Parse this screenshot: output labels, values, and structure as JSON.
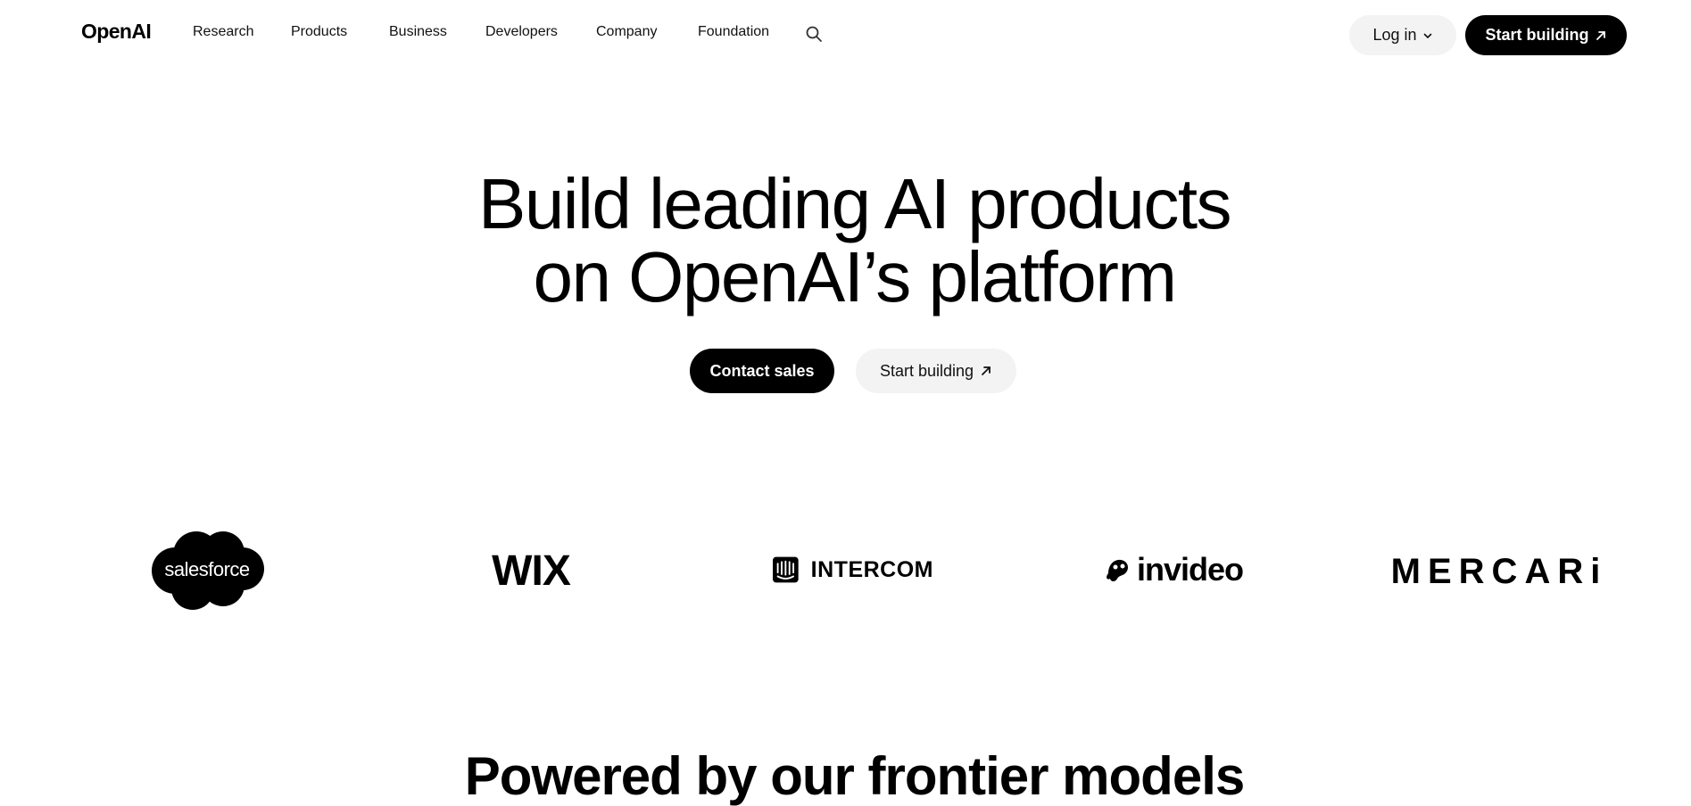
{
  "header": {
    "logo": "OpenAI",
    "nav": [
      {
        "label": "Research"
      },
      {
        "label": "Products"
      },
      {
        "label": "Business"
      },
      {
        "label": "Developers"
      },
      {
        "label": "Company"
      },
      {
        "label": "Foundation"
      }
    ],
    "search_icon": "search-icon",
    "login_label": "Log in",
    "start_label": "Start building"
  },
  "hero": {
    "title_line1": "Build leading AI products",
    "title_line2": "on OpenAI’s platform",
    "contact_label": "Contact sales",
    "start_label": "Start building"
  },
  "logos": {
    "salesforce": "salesforce",
    "wix": "WIX",
    "intercom": "INTERCOM",
    "invideo": "invideo",
    "mercari": "MERCARi"
  },
  "powered": {
    "title": "Powered by our frontier models"
  },
  "colors": {
    "primary": "#000000",
    "secondary_bg": "#f3f3f3",
    "background": "#ffffff"
  }
}
